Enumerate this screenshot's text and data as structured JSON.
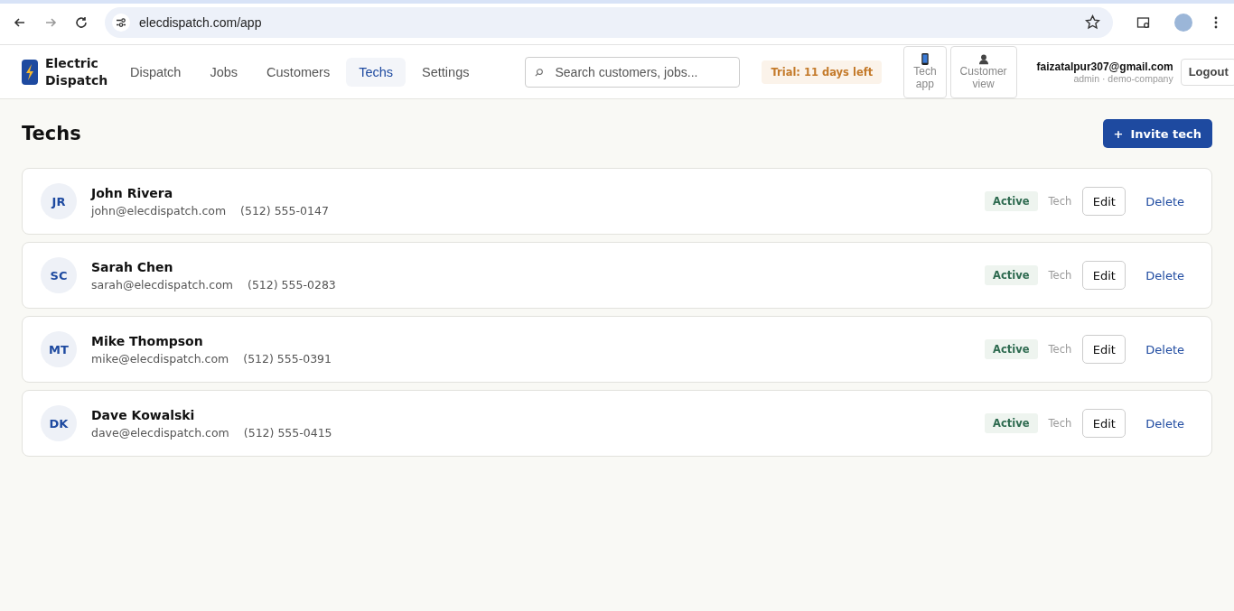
{
  "browser": {
    "url": "elecdispatch.com/app"
  },
  "app": {
    "brand": "Electric Dispatch",
    "nav": [
      {
        "label": "Dispatch",
        "selected": false
      },
      {
        "label": "Jobs",
        "selected": false
      },
      {
        "label": "Customers",
        "selected": false
      },
      {
        "label": "Techs",
        "selected": true
      },
      {
        "label": "Settings",
        "selected": false
      }
    ],
    "search": {
      "placeholder": "Search customers, jobs..."
    },
    "trial_badge": "Trial: 11 days left",
    "view_buttons": [
      {
        "kind": "phone",
        "label": "Tech app"
      },
      {
        "kind": "person",
        "label": "Customer view"
      }
    ],
    "user": {
      "email": "faizatalpur307@gmail.com",
      "role": "admin · demo-company"
    },
    "logout": "Logout"
  },
  "page": {
    "title": "Techs",
    "invite_button": "Invite tech",
    "invite_icon": "+"
  },
  "techs": [
    {
      "initials": "JR",
      "name": "John Rivera",
      "email": "john@elecdispatch.com",
      "phone": "(512) 555-0147",
      "status": "Active",
      "role": "Tech",
      "edit": "Edit",
      "delete": "Delete"
    },
    {
      "initials": "SC",
      "name": "Sarah Chen",
      "email": "sarah@elecdispatch.com",
      "phone": "(512) 555-0283",
      "status": "Active",
      "role": "Tech",
      "edit": "Edit",
      "delete": "Delete"
    },
    {
      "initials": "MT",
      "name": "Mike Thompson",
      "email": "mike@elecdispatch.com",
      "phone": "(512) 555-0391",
      "status": "Active",
      "role": "Tech",
      "edit": "Edit",
      "delete": "Delete"
    },
    {
      "initials": "DK",
      "name": "Dave Kowalski",
      "email": "dave@elecdispatch.com",
      "phone": "(512) 555-0415",
      "status": "Active",
      "role": "Tech",
      "edit": "Edit",
      "delete": "Delete"
    }
  ]
}
